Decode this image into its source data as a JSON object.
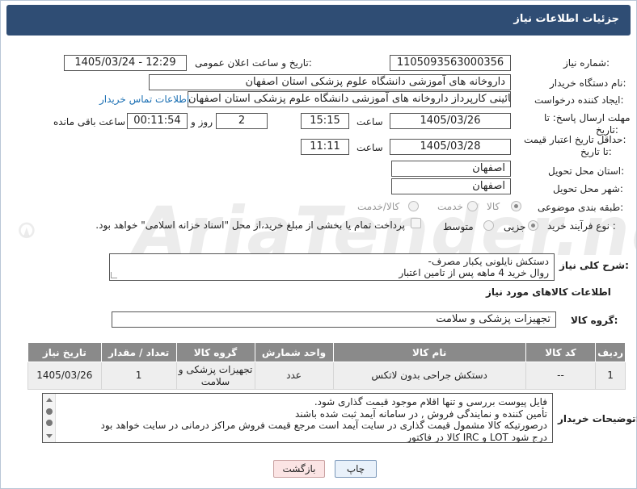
{
  "header": {
    "title": "جزئیات اطلاعات نیاز"
  },
  "fields": {
    "need_number": {
      "label": "شماره نیاز:",
      "value": "1105093563000356"
    },
    "announce_datetime": {
      "label": "تاریخ و ساعت اعلان عمومی:",
      "value": "1405/03/24 - 12:29"
    },
    "buyer_org": {
      "label": "نام دستگاه خریدار:",
      "value": "داروخانه های آموزشی دانشگاه علوم پزشکی استان اصفهان"
    },
    "requester": {
      "label": "ایجاد کننده درخواست:",
      "value": "رضا طیبی نائینی کارپرداز داروخانه های آموزشی دانشگاه علوم پزشکی استان اصفهان",
      "contact_link": "اطلاعات تماس خریدار"
    },
    "reply_deadline": {
      "label_line1": "مهلت ارسال پاسخ: تا",
      "label_line2": "تاریخ:",
      "date": "1405/03/26",
      "time_label": "ساعت",
      "time": "15:15",
      "days": "2",
      "days_label": "روز و",
      "remaining": "00:11:54",
      "remaining_label": "ساعت باقی مانده"
    },
    "price_validity": {
      "label_line1": "حداقل تاریخ اعتبار قیمت:",
      "label_line2": "تا تاریخ:",
      "date": "1405/03/28",
      "time_label": "ساعت",
      "time": "11:11"
    },
    "delivery_province": {
      "label": "استان محل تحویل:",
      "value": "اصفهان"
    },
    "delivery_city": {
      "label": "شهر محل تحویل:",
      "value": "اصفهان"
    },
    "category": {
      "label": "طبقه بندی موضوعی:",
      "options": [
        "کالا",
        "خدمت",
        "کالا/خدمت"
      ],
      "selected": "کالا"
    },
    "purchase_process": {
      "label": "نوع فرآیند خرید :",
      "options": [
        "جزیی",
        "متوسط"
      ],
      "selected": "جزیی",
      "payment_note": "پرداخت تمام یا بخشی از مبلغ خرید،از محل \"اسناد خزانه اسلامی\" خواهد بود."
    }
  },
  "description": {
    "label": "شرح کلی نیاز:",
    "lines": [
      "دستکش نایلونی یکبار مصرف-",
      "روال خرید 4 ماهه پس از تامین اعتبار"
    ]
  },
  "goods_section": {
    "title": "اطلاعات کالاهای مورد نیاز",
    "group_label": "گروه کالا:",
    "group_value": "تجهیزات پزشکی و سلامت"
  },
  "table": {
    "headers": [
      "ردیف",
      "کد کالا",
      "نام کالا",
      "واحد شمارش",
      "گروه کالا",
      "تعداد / مقدار",
      "تاریخ نیاز"
    ],
    "rows": [
      [
        "1",
        "--",
        "دستکش جراحی بدون لاتکس",
        "عدد",
        "تجهیزات پزشکی و سلامت",
        "1",
        "1405/03/26"
      ]
    ]
  },
  "buyer_notes": {
    "label": "توضیحات خریدار:",
    "lines": [
      "فایل پیوست بررسی و تنها اقلام موجود قیمت گذاری شود.",
      "تأمین کننده و نمایندگی فروش  , در سامانه آیمد ثبت شده باشند",
      "درصورتیکه کالا مشمول قیمت گذاری در سایت آیمد است مرجع قیمت فروش مراکز درمانی در سایت خواهد بود",
      "درج شود LOT و IRC کالا در فاکتور"
    ]
  },
  "buttons": {
    "print": "چاپ",
    "back": "بازگشت"
  },
  "watermark": "AriaTender.net",
  "colors": {
    "header_bg": "#2f4d74",
    "table_header_bg": "#8a8a8a",
    "link": "#1a6fb3"
  }
}
